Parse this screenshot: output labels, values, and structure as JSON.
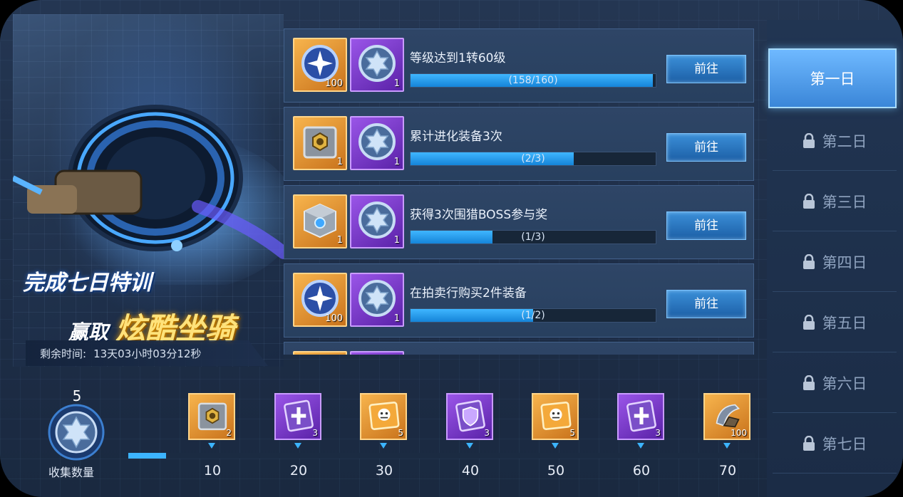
{
  "banner": {
    "slogan_line1": "完成七日特训",
    "slogan_line2a": "赢取",
    "slogan_line2b": "炫酷坐骑",
    "timer_label": "剩余时间:",
    "timer_value": "13天03小时03分12秒"
  },
  "tasks": [
    {
      "title": "等级达到1转60级",
      "progress_text": "(158/160)",
      "progress": 0.9875,
      "button": "前往",
      "rewards": [
        {
          "icon": "star-orb-icon",
          "color": "orange",
          "count": "100"
        },
        {
          "icon": "star-badge-icon",
          "color": "purple",
          "count": "1"
        }
      ]
    },
    {
      "title": "累计进化装备3次",
      "progress_text": "(2/3)",
      "progress": 0.667,
      "button": "前往",
      "rewards": [
        {
          "icon": "gear-box-icon",
          "color": "orange",
          "count": "1"
        },
        {
          "icon": "star-badge-icon",
          "color": "purple",
          "count": "1"
        }
      ]
    },
    {
      "title": "获得3次围猎BOSS参与奖",
      "progress_text": "(1/3)",
      "progress": 0.333,
      "button": "前往",
      "rewards": [
        {
          "icon": "cube-chest-icon",
          "color": "orange",
          "count": "1"
        },
        {
          "icon": "star-badge-icon",
          "color": "purple",
          "count": "1"
        }
      ]
    },
    {
      "title": "在拍卖行购买2件装备",
      "progress_text": "(1/2)",
      "progress": 0.5,
      "button": "前往",
      "rewards": [
        {
          "icon": "star-orb-icon",
          "color": "orange",
          "count": "100"
        },
        {
          "icon": "star-badge-icon",
          "color": "purple",
          "count": "1"
        }
      ]
    }
  ],
  "days": [
    {
      "label": "第一日",
      "locked": false,
      "active": true
    },
    {
      "label": "第二日",
      "locked": true,
      "active": false
    },
    {
      "label": "第三日",
      "locked": true,
      "active": false
    },
    {
      "label": "第四日",
      "locked": true,
      "active": false
    },
    {
      "label": "第五日",
      "locked": true,
      "active": false
    },
    {
      "label": "第六日",
      "locked": true,
      "active": false
    },
    {
      "label": "第七日",
      "locked": true,
      "active": false
    }
  ],
  "collection": {
    "count": "5",
    "label": "收集数量",
    "progress": 0.06,
    "milestones": [
      {
        "threshold": "10",
        "icon": "gear-box-icon",
        "color": "orange",
        "count": "2"
      },
      {
        "threshold": "20",
        "icon": "cross-card-icon",
        "color": "purple",
        "count": "3"
      },
      {
        "threshold": "30",
        "icon": "monster-card-icon",
        "color": "orange",
        "count": "5"
      },
      {
        "threshold": "40",
        "icon": "shield-card-icon",
        "color": "purple",
        "count": "3"
      },
      {
        "threshold": "50",
        "icon": "monster-card-icon",
        "color": "orange",
        "count": "5"
      },
      {
        "threshold": "60",
        "icon": "cross-card-icon",
        "color": "purple",
        "count": "3"
      },
      {
        "threshold": "70",
        "icon": "mount-piece-icon",
        "color": "orange",
        "count": "100"
      }
    ]
  },
  "colors": {
    "accent": "#3cb4ff",
    "orange": "#e8952e",
    "purple": "#7b3bd0",
    "active_tab": "#4a9be8"
  }
}
